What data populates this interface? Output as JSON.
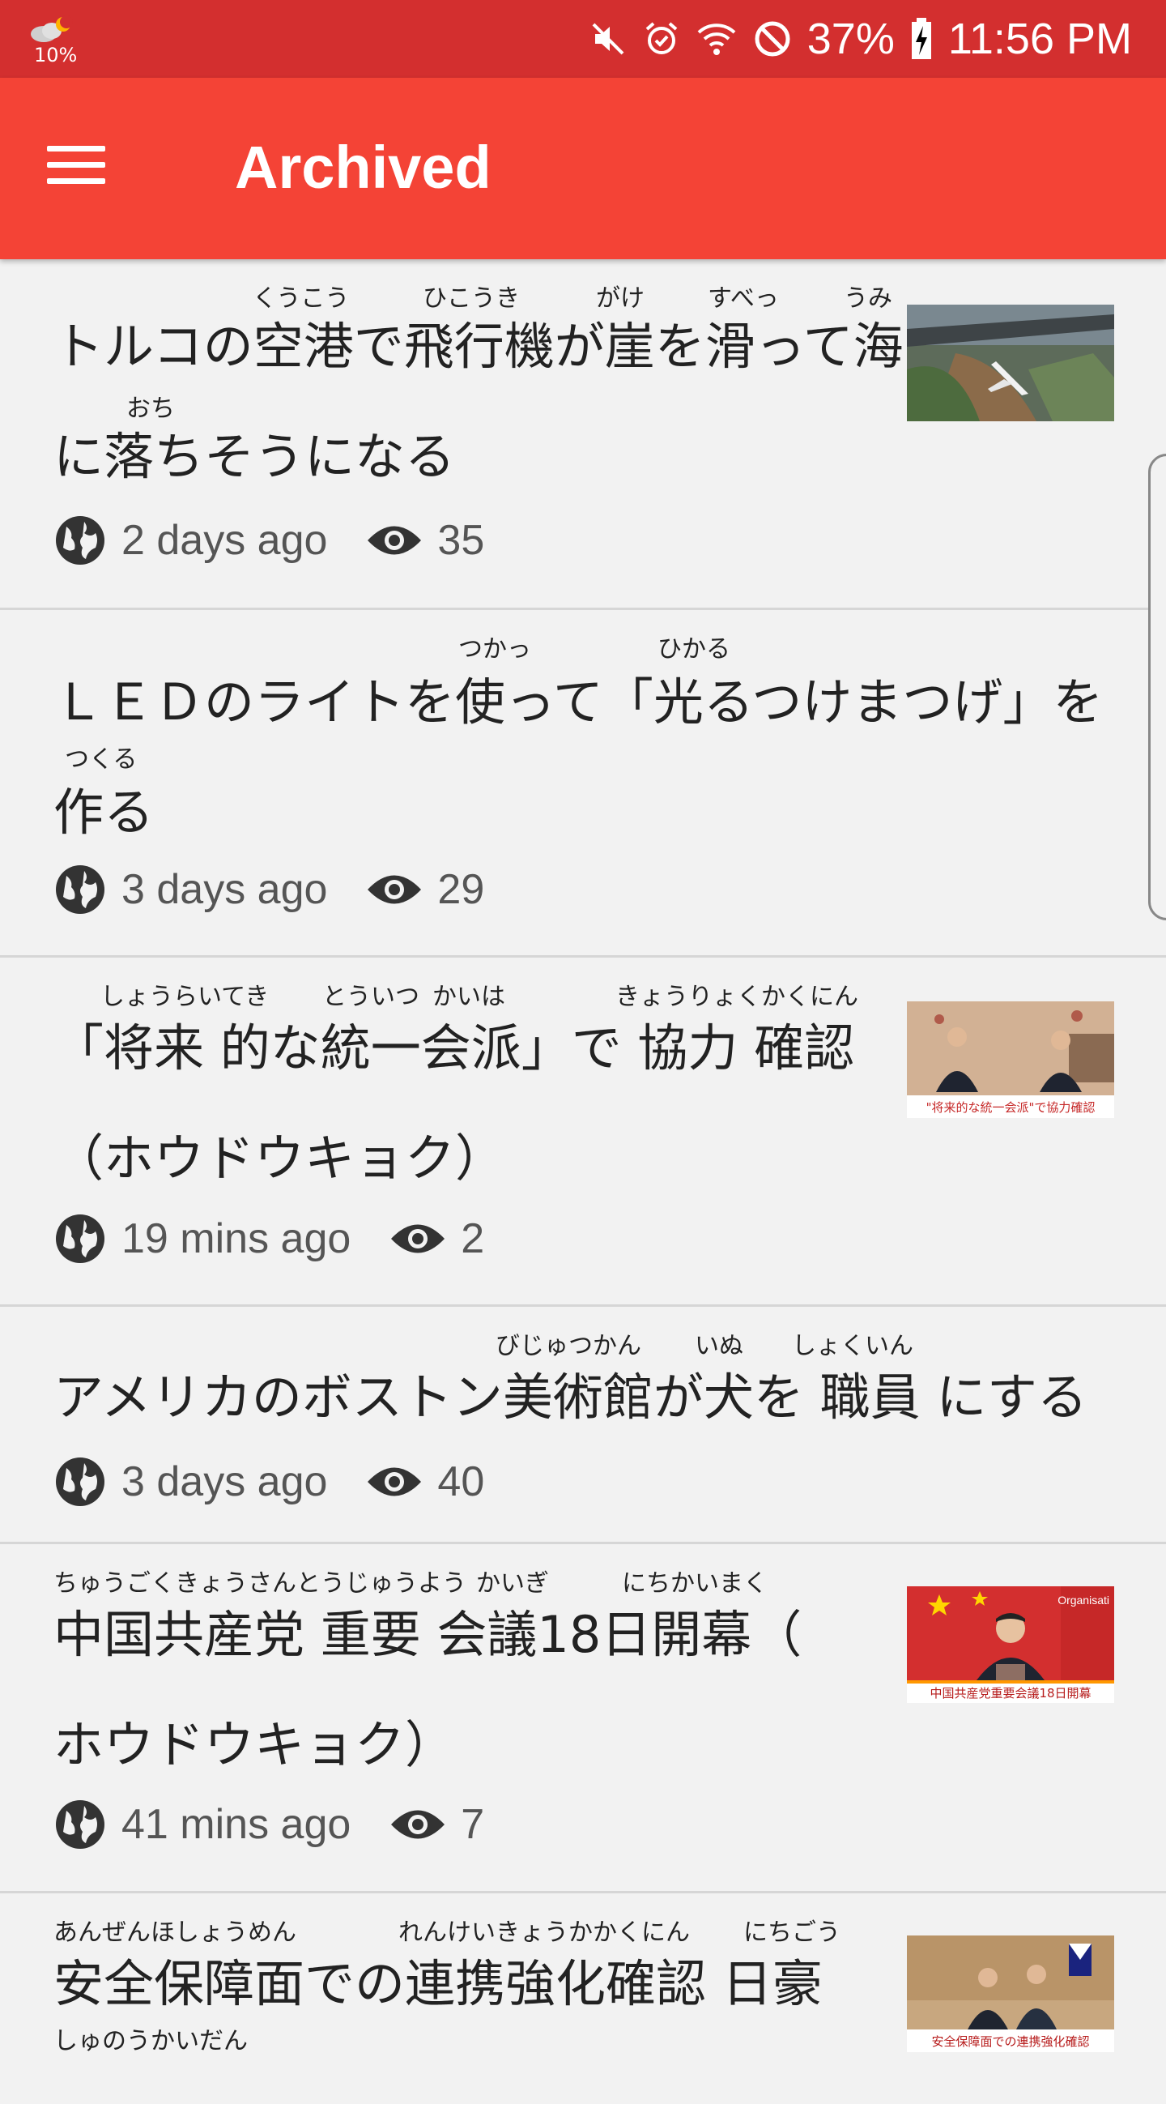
{
  "status_bar": {
    "weather_percent": "10%",
    "battery": "37%",
    "time": "11:56 PM",
    "icons": [
      "weather-icon",
      "mute-icon",
      "alarm-icon",
      "wifi-icon",
      "block-icon",
      "battery-charging-icon"
    ]
  },
  "app_bar": {
    "title": "Archived",
    "menu_icon": "menu-icon"
  },
  "items": [
    {
      "line1": "トルコの空港で飛行機が崖を滑って海",
      "line2": "に落ちそうになる",
      "ruby": [
        "くうこう",
        "ひこうき",
        "がけ",
        "すべっ",
        "うみ",
        "おち"
      ],
      "time": "2 days ago",
      "views": "35",
      "thumb": "runway-cliff-plane"
    },
    {
      "line1": "ＬＥＤのライトを使って「光るつけまつげ」を",
      "line2": "作る",
      "ruby": [
        "つかっ",
        "ひかる",
        "つくる"
      ],
      "time": "3 days ago",
      "views": "29",
      "thumb": ""
    },
    {
      "line1": "「将来 的な統一会派」で 協力 確認",
      "line2": "（ホウドウキョク）",
      "ruby": [
        "しょうらいてき",
        "とういつ",
        "かいは",
        "きょうりょくかくにん"
      ],
      "time": "19 mins ago",
      "views": "2",
      "thumb": "politicians-meeting",
      "thumb_caption": "\"将来的な統一会派\"で協力確認"
    },
    {
      "line1": "アメリカのボストン美術館が犬を 職員 にする",
      "line2": "",
      "ruby": [
        "びじゅつかん",
        "いぬ",
        "しょくいん"
      ],
      "time": "3 days ago",
      "views": "40",
      "thumb": ""
    },
    {
      "line1": " 中国共産党  重要 会議18日開幕（",
      "line2": "ホウドウキョク）",
      "ruby": [
        "ちゅうごくきょうさんとうじゅうよう",
        "かいぎ",
        "にちかいまく"
      ],
      "time": "41 mins ago",
      "views": "7",
      "thumb": "china-leader-speech",
      "thumb_caption": "中国共産党重要会議18日開幕",
      "thumb_overlay": "Organisati"
    },
    {
      "line1": "安全保障面での連携強化確認  日豪",
      "line2": "",
      "ruby": [
        "あんぜんほしょうめん",
        "れんけいきょうかかくにん",
        "にちごう",
        "しゅのうかいだん"
      ],
      "time": "",
      "views": "",
      "thumb": "leaders-handshake",
      "thumb_caption": "安全保障面での連携強化確認"
    }
  ]
}
